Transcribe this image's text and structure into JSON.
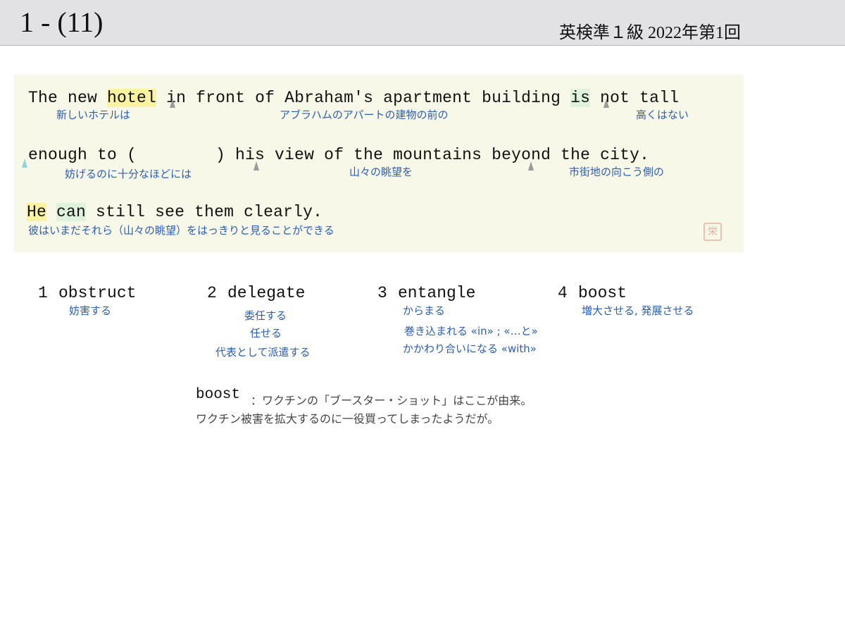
{
  "header": {
    "slide_number": "1 - (11)",
    "exam_title": "英検準１級  2022年第1回"
  },
  "sentence": {
    "line1": {
      "w_the_new": "The new ",
      "w_hotel": "hotel",
      "w_space1": " ",
      "w_in_front": "in front of Abraham's apartment building ",
      "w_is": "is",
      "w_not_tall": " not tall"
    },
    "line1_gloss": {
      "hotel": "新しいホテルは",
      "building": "アブラハムのアパートの建物の前の",
      "tall": "高くはない"
    },
    "line2": {
      "w_enough": "enough to (        ) his view of the mountains beyond the city."
    },
    "line2_gloss": {
      "enough": "妨げるのに十分なほどには",
      "view": "山々の眺望を",
      "city": "市街地の向こう側の"
    },
    "line3": {
      "w_he": "He",
      "w_space": " ",
      "w_can": "can",
      "w_rest": " still see them clearly."
    },
    "line3_gloss": {
      "he": "彼はいまだそれら（山々の眺望）をはっきりと見ることができる"
    },
    "seal_char": "栄"
  },
  "choices": [
    {
      "num": "1",
      "word": "obstruct",
      "meanings": [
        "妨害する"
      ]
    },
    {
      "num": "2",
      "word": "delegate",
      "meanings": [
        "委任する",
        "任せる",
        "代表として派遣する"
      ]
    },
    {
      "num": "3",
      "word": "entangle",
      "meanings": [
        "からまる",
        "巻き込まれる «in» ; «…と»",
        "かかわり合いになる «with»"
      ]
    },
    {
      "num": "4",
      "word": "boost",
      "meanings": [
        "増大させる, 発展させる"
      ]
    }
  ],
  "note": {
    "word": "boost",
    "line1": "：ワクチンの「ブースター・ショット」はここが由来。",
    "line2": "ワクチン被害を拡大するのに一役買ってしまったようだが。"
  }
}
